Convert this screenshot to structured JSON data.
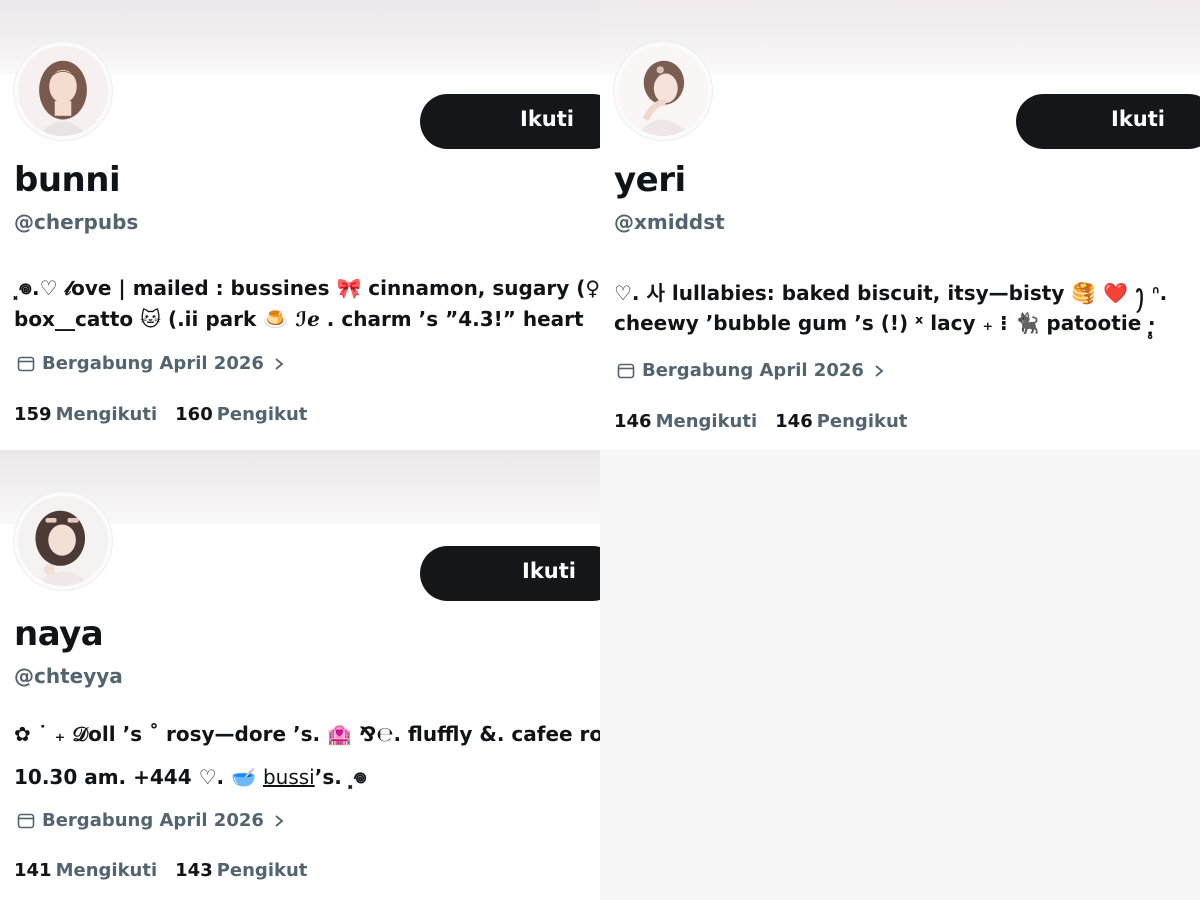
{
  "profiles": [
    {
      "name": "bunni",
      "handle": "@cherpubs",
      "follow_label": "Ikuti",
      "avatar_icon": "avatar-photo",
      "bio_line_1": "⸼𖦹.♡ 𝓁ove | mailed : bussines 🎀 cinnamon, sugary (♀",
      "bio_line_2": "box__catto 🐱 (.ii park 🍮 ℐℯ . charm ’s ”4.3!” heart",
      "joined": "Bergabung April 2026",
      "following_count": "159",
      "following_label": "Mengikuti",
      "followers_count": "160",
      "followers_label": "Pengikut"
    },
    {
      "name": "yeri",
      "handle": "@xmiddst",
      "follow_label": "Ikuti",
      "avatar_icon": "avatar-photo",
      "bio_line_1": "♡. 사 lullabies: baked biscuit, itsy—bisty 🥞 ❤️ ꫂ ᐢ.",
      "bio_line_2": "cheewy ’bubble gum ’s (!) ˣ lacy ₊ ⁝ 🐈‍⬛ patootie ‧̣̥",
      "joined": "Bergabung April 2026",
      "following_count": "146",
      "following_label": "Mengikuti",
      "followers_count": "146",
      "followers_label": "Pengikut"
    },
    {
      "name": "naya",
      "handle": "@chteyya",
      "follow_label": "Ikuti",
      "avatar_icon": "avatar-photo",
      "bio_line_1": "✿ ˙ ₊ 𝒟oll ’s ˚ rosy—dore ’s. 🏩 ⅋℮. fluffly &. cafee roll",
      "bio_line_2_a": "10.30 am. +444 ♡. 🥣 ",
      "bio_line_2_b": "bussi",
      "bio_line_2_c": "’s. ⸼𖦹",
      "joined": "Bergabung April 2026",
      "following_count": "141",
      "following_label": "Mengikuti",
      "followers_count": "143",
      "followers_label": "Pengikut"
    }
  ],
  "colors": {
    "button_bg": "#14171a",
    "secondary_text": "#536471",
    "primary_text": "#0f1419"
  }
}
